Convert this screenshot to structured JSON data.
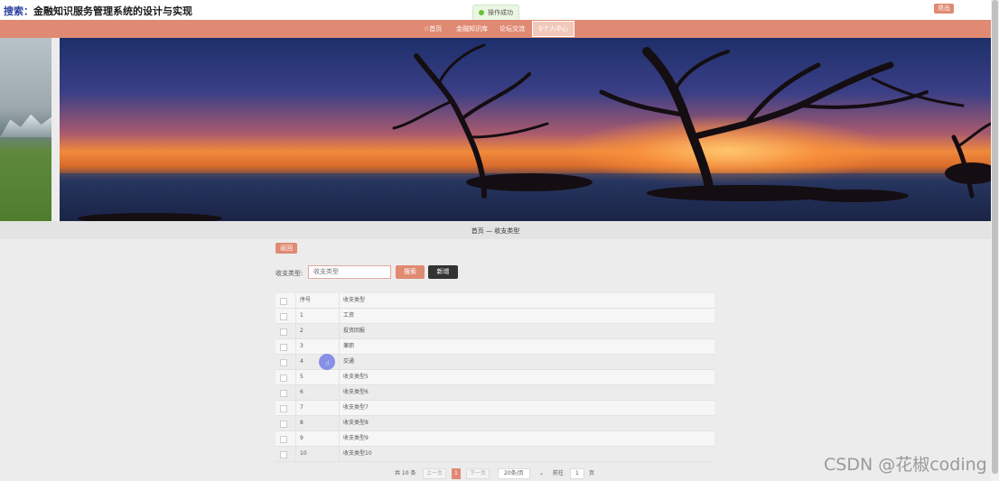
{
  "header": {
    "title_prefix": "搜索：",
    "title": "金融知识服务管理系统的设计与实现",
    "logout": "退出",
    "toast": "操作成功"
  },
  "nav": {
    "items": [
      {
        "label": "☆首页"
      },
      {
        "label": "金融知识库"
      },
      {
        "label": "论坛交流"
      },
      {
        "label": "♀个人中心"
      }
    ]
  },
  "breadcrumb": {
    "home": "首页",
    "sep": "—",
    "current": "收支类型"
  },
  "toolbar": {
    "back": "返回",
    "search_label": "收支类型:",
    "search_placeholder": "收支类型",
    "search_button": "搜索",
    "add_button": "新增"
  },
  "table": {
    "headers": {
      "no": "序号",
      "type": "收支类型"
    },
    "rows": [
      {
        "no": "1",
        "type": "工资"
      },
      {
        "no": "2",
        "type": "投资回报"
      },
      {
        "no": "3",
        "type": "兼职"
      },
      {
        "no": "4",
        "type": "交通"
      },
      {
        "no": "5",
        "type": "收支类型5"
      },
      {
        "no": "6",
        "type": "收支类型6"
      },
      {
        "no": "7",
        "type": "收支类型7"
      },
      {
        "no": "8",
        "type": "收支类型8"
      },
      {
        "no": "9",
        "type": "收支类型9"
      },
      {
        "no": "10",
        "type": "收支类型10"
      }
    ]
  },
  "pagination": {
    "total": "共 10 条",
    "prev": "上一页",
    "current": "1",
    "next": "下一页",
    "page_size": "20条/页",
    "jump_label": "前往",
    "jump_value": "1",
    "page_unit": "页"
  },
  "watermark": "CSDN @花椒coding",
  "colors": {
    "accent": "#e08a73",
    "dark_button": "#333333",
    "success": "#67c23a"
  }
}
